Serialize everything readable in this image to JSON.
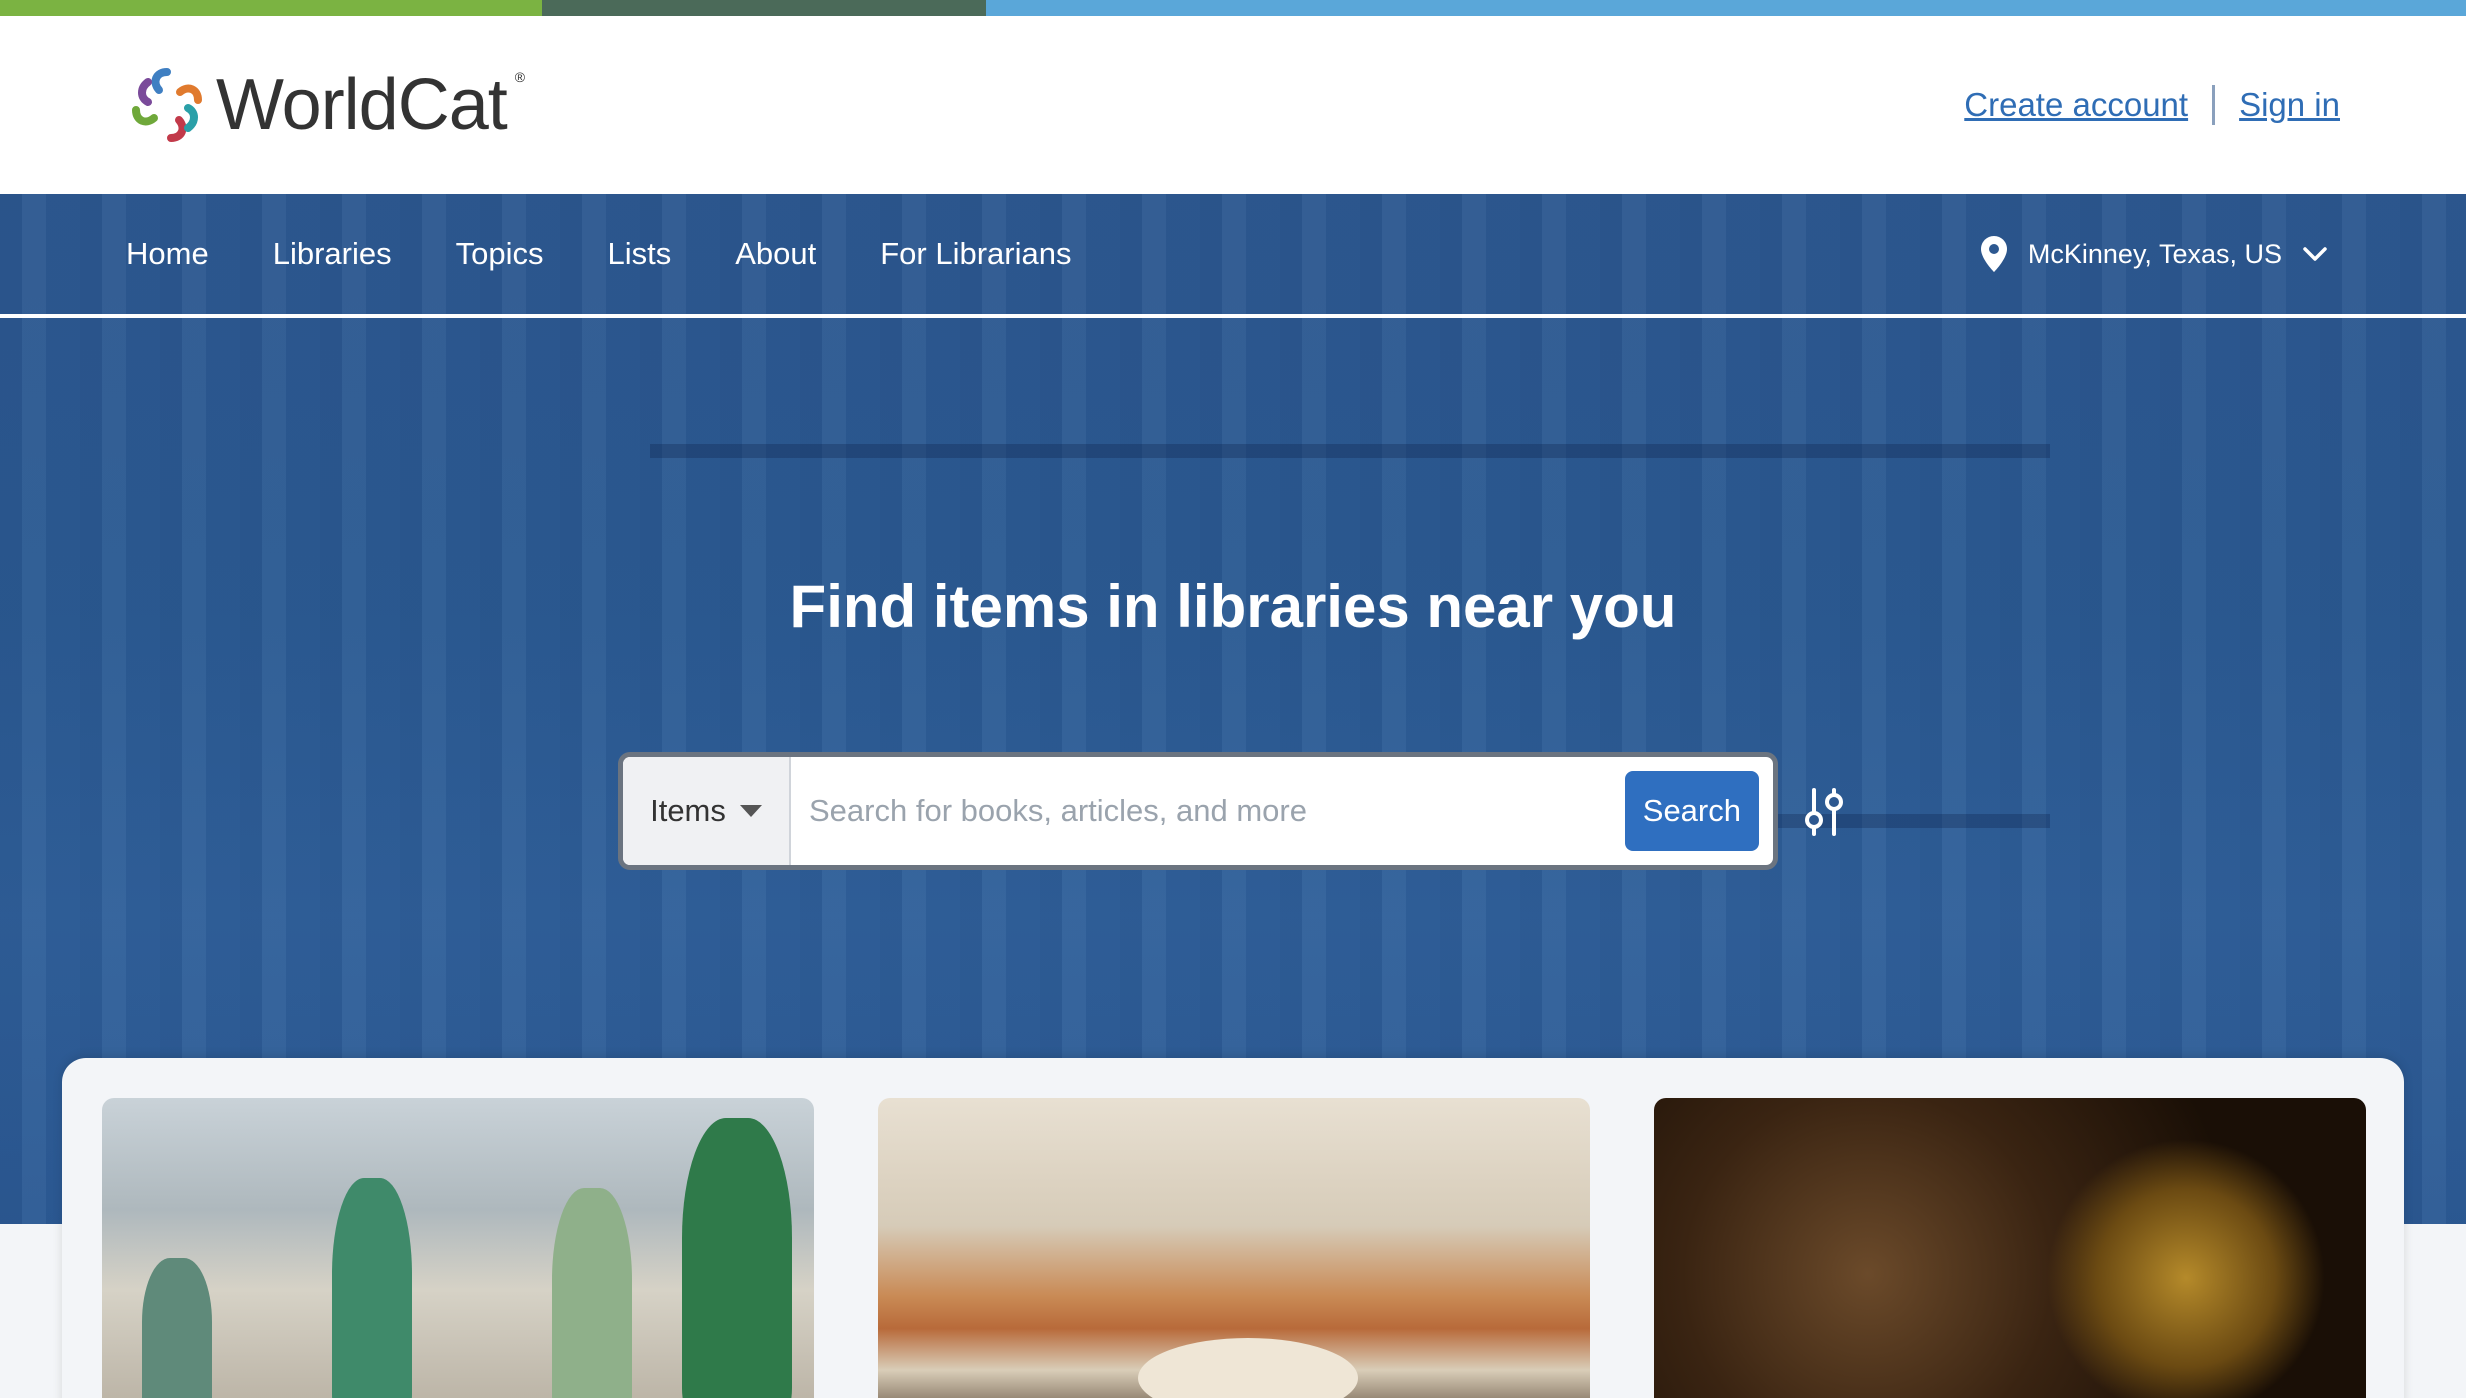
{
  "brand": {
    "name": "WorldCat",
    "reg_mark": "®"
  },
  "account": {
    "create_label": "Create account",
    "signin_label": "Sign in"
  },
  "nav": {
    "items": [
      {
        "label": "Home"
      },
      {
        "label": "Libraries"
      },
      {
        "label": "Topics"
      },
      {
        "label": "Lists"
      },
      {
        "label": "About"
      },
      {
        "label": "For Librarians"
      }
    ],
    "location": "McKinney, Texas, US"
  },
  "hero": {
    "title": "Find items in libraries near you"
  },
  "search": {
    "type_selected": "Items",
    "placeholder": "Search for books, articles, and more",
    "value": "",
    "button_label": "Search"
  },
  "colors": {
    "strip_green": "#7bb342",
    "strip_dark": "#4b6a59",
    "strip_blue": "#5aa7d9",
    "hero_blue": "#2d5890",
    "link_blue": "#2f6db5",
    "button_blue": "#2f6fc0"
  },
  "icons": {
    "logo": "worldcat-swirl-icon",
    "location": "map-pin-icon",
    "dropdown": "chevron-down-icon",
    "advanced": "sliders-icon"
  }
}
